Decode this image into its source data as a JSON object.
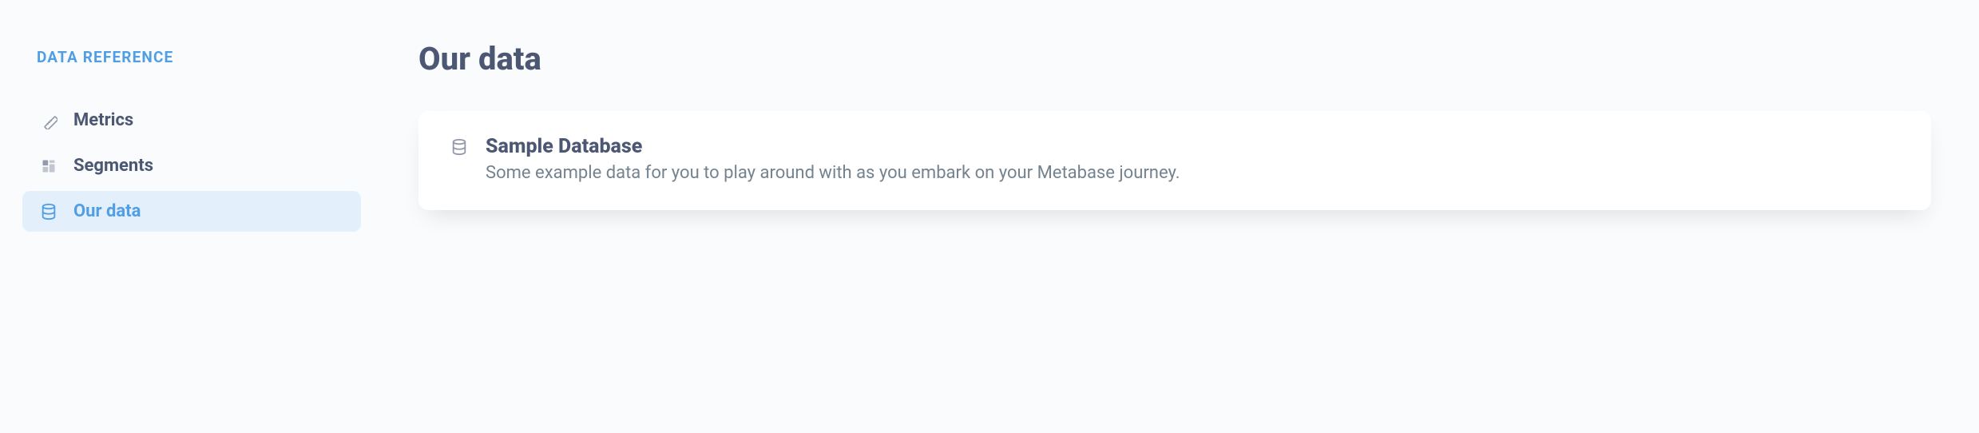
{
  "sidebar": {
    "title": "DATA REFERENCE",
    "items": [
      {
        "label": "Metrics",
        "icon": "ruler-icon",
        "active": false
      },
      {
        "label": "Segments",
        "icon": "segments-icon",
        "active": false
      },
      {
        "label": "Our data",
        "icon": "database-icon",
        "active": true
      }
    ]
  },
  "main": {
    "title": "Our data",
    "databases": [
      {
        "icon": "database-icon",
        "title": "Sample Database",
        "description": "Some example data for you to play around with as you embark on your Metabase journey."
      }
    ]
  }
}
